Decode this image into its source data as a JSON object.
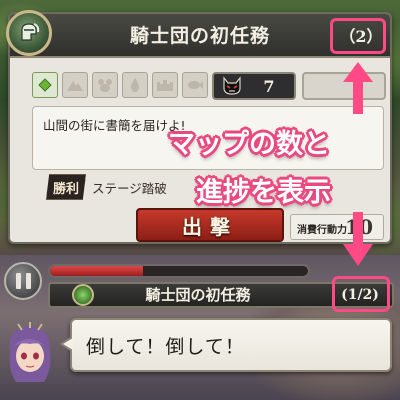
{
  "stage_panel": {
    "emblem_icon": "knight-helmet-emblem",
    "title": "騎士団の初任務",
    "map_count": "（2）",
    "terrain_icons": [
      "leaf-icon",
      "mountain-icon",
      "beast-icon",
      "water-drop-icon",
      "castle-icon",
      "fish-icon"
    ],
    "enemy_icon": "demon-face-icon",
    "enemy_count": "7",
    "mission_text": "山間の街に書簡を届けよ!",
    "victory_badge": "勝利",
    "victory_condition": "ステージ踏破",
    "sortie_label": "出撃",
    "ap_label": "消費行動力",
    "ap_value": "10"
  },
  "annotation": {
    "line1": "マップの数と",
    "line2": "進捗を表示",
    "accent_color": "#ff4a86"
  },
  "battle_hud": {
    "pause_icon": "pause-icon",
    "hp_fraction": 0.36,
    "stage_title": "騎士団の初任務",
    "progress": "(1/2)",
    "speech_text": "倒して！倒して！",
    "portrait": "purple-haired-character-portrait"
  }
}
